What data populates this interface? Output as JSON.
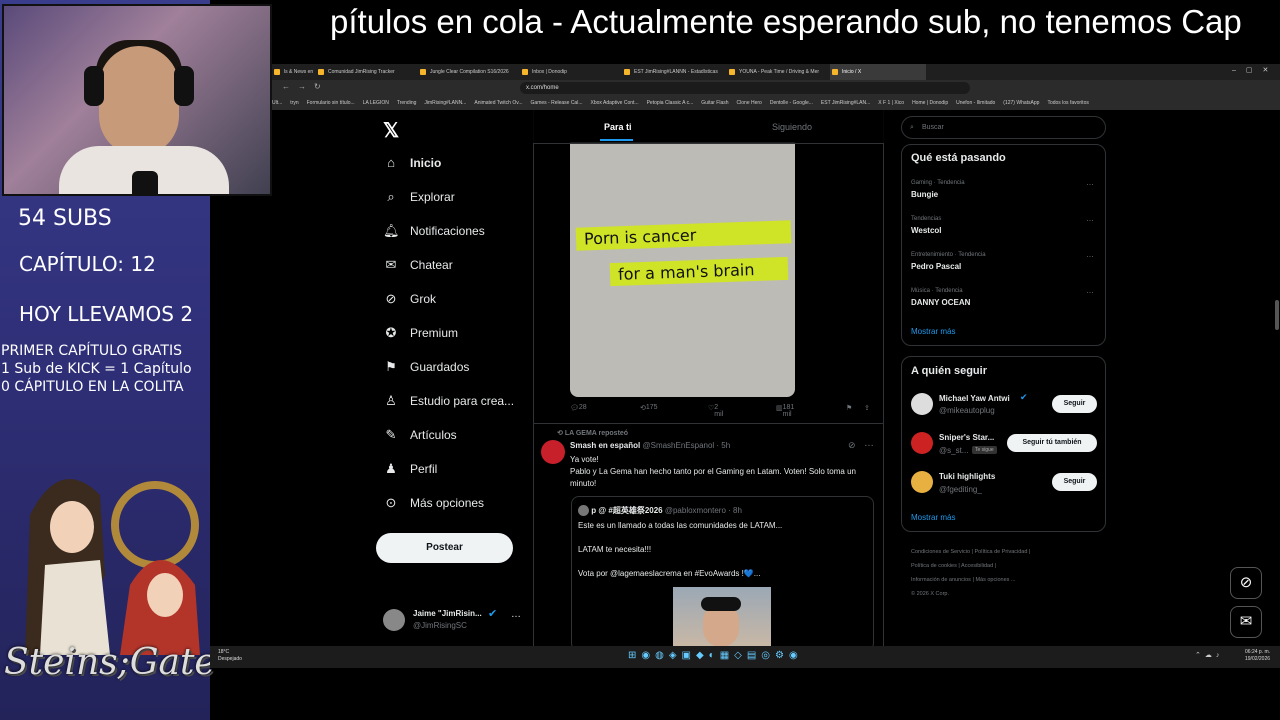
{
  "ticker": "pítulos en cola - Actualmente esperando sub, no tenemos Cap",
  "overlay": {
    "subs": "54 SUBS",
    "capitulo": "CAPÍTULO: 12",
    "hoy": "HOY LLEVAMOS 2",
    "rule1": "PRIMER CAPÍTULO GRATIS",
    "rule2": "1 Sub de KICK = 1 Capítulo",
    "rule3": "0 CÁPITULO EN LA COLITA",
    "logo": "Steins;Gate"
  },
  "browser": {
    "tabs": [
      "ls & News en",
      "Comunidad JimRising Tracker",
      "Jungle Clear Compilation S16/2026",
      "Inbox | Donodip",
      "EST JimRising#LANNN - Estadísticas",
      "YOUNA - Peak Time / Driving & Mer",
      "Inicio / X"
    ],
    "url": "x.com/home",
    "bookmarks": [
      "Ult...",
      "tryn",
      "Formulario sin título...",
      "LA LEGION",
      "Trending",
      "JimRising#LANN...",
      "Animated Twitch Ov...",
      "Games - Release Cal...",
      "Xbox Adaptive Cont...",
      "Petopia Classic A c...",
      "Guitar Flash",
      "Clone Hero",
      "Dentolle - Google...",
      "EST JimRising#LAN...",
      "X F 1 | Xico",
      "Home | Donodip",
      "Unefon - Ilimitado",
      "(127) WhatsApp",
      "Todos los favoritos"
    ]
  },
  "nav": {
    "home": "Inicio",
    "explore": "Explorar",
    "notifications": "Notificaciones",
    "chat": "Chatear",
    "grok": "Grok",
    "premium": "Premium",
    "saved": "Guardados",
    "studio": "Estudio para crea...",
    "articles": "Artículos",
    "profile": "Perfil",
    "more": "Más opciones",
    "post": "Postear",
    "account_name": "Jaime \"JimRisin...",
    "account_handle": "@JimRisingSC"
  },
  "feed": {
    "tab_foryou": "Para ti",
    "tab_following": "Siguiendo",
    "post1": {
      "strip1": "Porn is cancer",
      "strip2": "for a man's brain",
      "replies": "28",
      "reposts": "175",
      "likes": "2 mil",
      "views": "181 mil"
    },
    "post2": {
      "reposted_by": "LA GEMA reposteó",
      "name": "Smash en español",
      "handle": "@SmashEnEspanol · 5h",
      "line1": "Ya vote!",
      "line2": "Pablo y La Gema han hecho tanto por el Gaming en Latam. Voten! Solo toma un minuto!",
      "quote": {
        "name": "p @ #超英雄祭2026",
        "handle": "@pabloxmontero · 8h",
        "line1": "Este es un llamado a todas las comunidades de LATAM...",
        "line2": "LATAM te necesita!!!",
        "line3": "Vota por @lagemaeslacrema en #EvoAwards !💙..."
      }
    }
  },
  "right": {
    "search_placeholder": "Buscar",
    "trends_title": "Qué está pasando",
    "trends": [
      {
        "meta": "Gaming · Tendencia",
        "name": "Bungie"
      },
      {
        "meta": "Tendencias",
        "name": "Westcol"
      },
      {
        "meta": "Entretenimiento · Tendencia",
        "name": "Pedro Pascal"
      },
      {
        "meta": "Música · Tendencia",
        "name": "DANNY OCEAN"
      }
    ],
    "show_more": "Mostrar más",
    "follow_title": "A quién seguir",
    "follow": [
      {
        "name": "Michael Yaw Antwi",
        "handle": "@mikeautoplug",
        "button": "Seguir"
      },
      {
        "name": "Sniper's Star...",
        "handle": "@s_st...",
        "badge": "Te sigue",
        "button": "Seguir tú también"
      },
      {
        "name": "Tuki highlights",
        "handle": "@fgediting_",
        "button": "Seguir"
      }
    ],
    "footer": [
      "Condiciones de Servicio",
      "Política de Privacidad",
      "Política de cookies",
      "Accesibilidad",
      "Información de anuncios",
      "Más opciones ...",
      "© 2026 X Corp."
    ]
  },
  "taskbar": {
    "temp": "18°C",
    "weather": "Despejado",
    "time": "06:24 p. m.",
    "date": "19/02/2026"
  }
}
